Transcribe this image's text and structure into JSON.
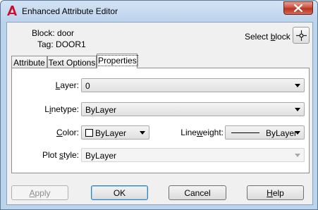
{
  "window": {
    "title": "Enhanced Attribute Editor",
    "close_glyph": "×"
  },
  "info": {
    "block_label": "Block:",
    "block_value": "door",
    "tag_label": "Tag:",
    "tag_value": "DOOR1",
    "select_block_pre": "Select ",
    "select_block_key": "b",
    "select_block_post": "lock"
  },
  "tabs": [
    {
      "label": "Attribute",
      "active": false
    },
    {
      "label": "Text Options",
      "active": false
    },
    {
      "label": "Properties",
      "active": true
    }
  ],
  "properties": {
    "layer_key": "L",
    "layer_rest": "ayer:",
    "layer_value": "0",
    "linetype_pre": "L",
    "linetype_key": "i",
    "linetype_post": "netype:",
    "linetype_value": "ByLayer",
    "color_key": "C",
    "color_rest": "olor:",
    "color_value": "ByLayer",
    "lineweight_pre": "Line",
    "lineweight_key": "w",
    "lineweight_post": "eight:",
    "lineweight_value": "ByLayer",
    "plotstyle_pre": "Plot ",
    "plotstyle_key": "s",
    "plotstyle_post": "tyle:",
    "plotstyle_value": "ByLayer"
  },
  "buttons": {
    "apply_key": "A",
    "apply_rest": "pply",
    "ok": "OK",
    "cancel": "Cancel",
    "help_key": "H",
    "help_rest": "elp"
  },
  "colors": {
    "title_bg": "#bcd3ec",
    "close_red": "#c9483a",
    "autocad_red": "#c8102e"
  },
  "icons": {
    "app": "autocad-logo-icon",
    "pick": "crosshair-pick-icon",
    "close": "close-icon"
  }
}
